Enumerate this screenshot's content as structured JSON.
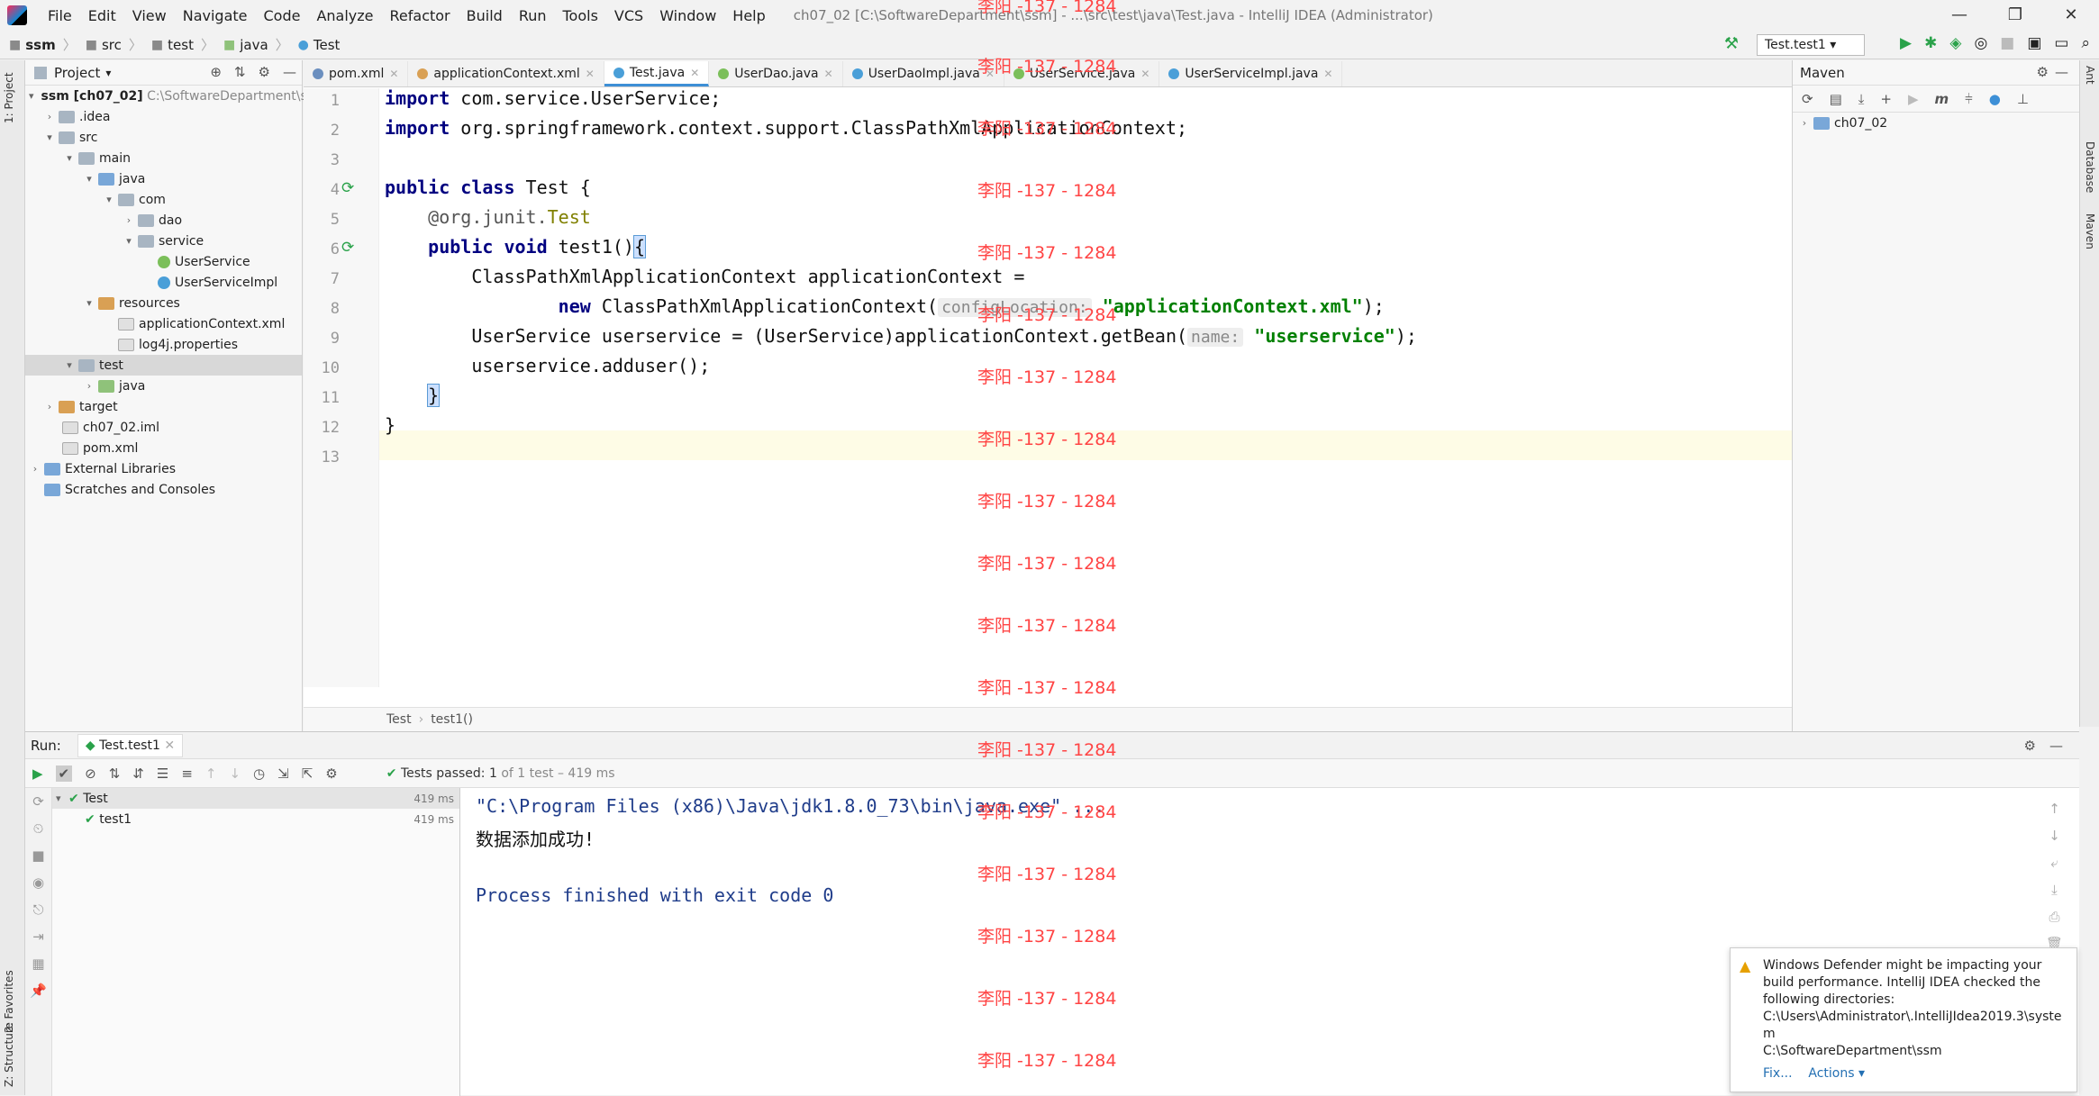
{
  "window": {
    "title": "ch07_02 [C:\\SoftwareDepartment\\ssm] - ...\\src\\test\\java\\Test.java - IntelliJ IDEA (Administrator)",
    "menu": [
      "File",
      "Edit",
      "View",
      "Navigate",
      "Code",
      "Analyze",
      "Refactor",
      "Build",
      "Run",
      "Tools",
      "VCS",
      "Window",
      "Help"
    ]
  },
  "breadcrumb": [
    "ssm",
    "src",
    "test",
    "java",
    "Test"
  ],
  "run_config": "Test.test1",
  "project": {
    "header": "Project",
    "tree": [
      {
        "label": "ssm [ch07_02]",
        "extra": "C:\\SoftwareDepartment\\ssm"
      },
      {
        "label": ".idea"
      },
      {
        "label": "src"
      },
      {
        "label": "main"
      },
      {
        "label": "java"
      },
      {
        "label": "com"
      },
      {
        "label": "dao"
      },
      {
        "label": "service"
      },
      {
        "label": "UserService"
      },
      {
        "label": "UserServiceImpl"
      },
      {
        "label": "resources"
      },
      {
        "label": "applicationContext.xml"
      },
      {
        "label": "log4j.properties"
      },
      {
        "label": "test"
      },
      {
        "label": "java"
      },
      {
        "label": "target"
      },
      {
        "label": "ch07_02.iml"
      },
      {
        "label": "pom.xml"
      },
      {
        "label": "External Libraries"
      },
      {
        "label": "Scratches and Consoles"
      }
    ]
  },
  "tabs": [
    "pom.xml",
    "applicationContext.xml",
    "Test.java",
    "UserDao.java",
    "UserDaoImpl.java",
    "UserService.java",
    "UserServiceImpl.java"
  ],
  "line_numbers": [
    "1",
    "2",
    "3",
    "4",
    "5",
    "6",
    "7",
    "8",
    "9",
    "10",
    "11",
    "12",
    "13"
  ],
  "code": {
    "l1_kw": "import",
    "l1_rest": " com.service.UserService;",
    "l2_kw": "import",
    "l2_rest": " org.springframework.context.support.ClassPathXmlApplicationContext;",
    "l4_kw": "public class",
    "l4_rest": " Test {",
    "l5_ann": "    @org.junit.",
    "l5_ann2": "Test",
    "l6_kw": "    public void",
    "l6_rest": " test1()",
    "l6_brace": "{",
    "l7": "        ClassPathXmlApplicationContext applicationContext =",
    "l8_kw": "                new",
    "l8_rest": " ClassPathXmlApplicationContext(",
    "l8_hint": "configLocation:",
    "l8_str": "\"applicationContext.xml\"",
    "l8_end": ");",
    "l9_rest": "        UserService userservice = (UserService)applicationContext.getBean(",
    "l9_hint": "name:",
    "l9_str": "\"userservice\"",
    "l9_end": ");",
    "l10": "        userservice.adduser();",
    "l11_pre": "    ",
    "l11_brace": "}",
    "l12": "}"
  },
  "editor_breadcrumb": [
    "Test",
    "test1()"
  ],
  "maven": {
    "header": "Maven",
    "project": "ch07_02"
  },
  "run": {
    "label": "Run:",
    "tab": "Test.test1",
    "status": "Tests passed: 1",
    "status_detail": "of 1 test – 419 ms",
    "tree": [
      {
        "label": "Test",
        "ms": "419 ms"
      },
      {
        "label": "test1",
        "ms": "419 ms"
      }
    ],
    "console": [
      "\"C:\\Program Files (x86)\\Java\\jdk1.8.0_73\\bin\\java.exe\" ...",
      "数据添加成功!",
      "",
      "Process finished with exit code 0"
    ]
  },
  "notification": {
    "text": "Windows Defender might be impacting your build performance. IntelliJ IDEA checked the following directories:",
    "dir1": "C:\\Users\\Administrator\\.IntelliJIdea2019.3\\system",
    "dir2": "C:\\SoftwareDepartment\\ssm",
    "fix": "Fix...",
    "actions": "Actions ▾"
  },
  "watermark": "李阳 -137 - 1284",
  "side_labels": {
    "project": "1: Project",
    "favorites": "2: Favorites",
    "structure": "Z: Structure",
    "ant": "Ant",
    "database": "Database",
    "maven": "Maven"
  }
}
